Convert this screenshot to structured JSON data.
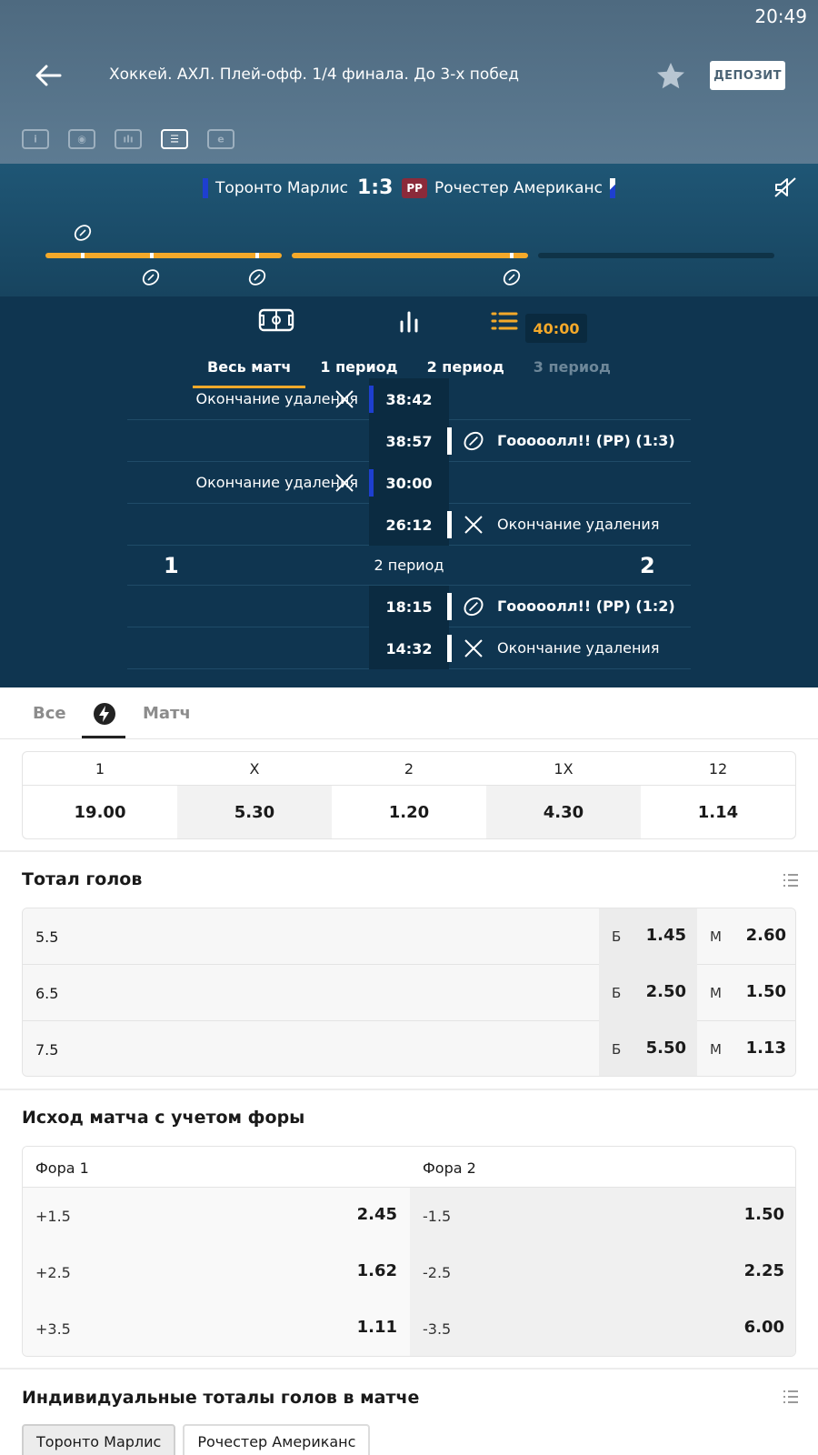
{
  "status": {
    "time": "20:49"
  },
  "header": {
    "title": "Хоккей. АХЛ. Плей-офф. 1/4 финала. До 3-х побед",
    "deposit_label": "ДЕПОЗИТ",
    "view_tabs": [
      "info",
      "field",
      "stats",
      "list",
      "e"
    ]
  },
  "scoreboard": {
    "home": "Торонто Марлис",
    "score": "1:3",
    "badge": "PP",
    "away": "Рочестер Американс"
  },
  "events_panel": {
    "timer": "40:00",
    "period_tabs": [
      "Весь матч",
      "1 период",
      "2 период",
      "3 период"
    ],
    "rows": [
      {
        "time": "38:42",
        "side": "left",
        "text": "Окончание удаления",
        "icon": "penalty-end-icon"
      },
      {
        "time": "38:57",
        "side": "right",
        "text": "Гооооолл!! (PP) (1:3)",
        "icon": "goal-puck-icon"
      },
      {
        "time": "30:00",
        "side": "left",
        "text": "Окончание удаления",
        "icon": "penalty-end-icon"
      },
      {
        "time": "26:12",
        "side": "right",
        "text": "Окончание удаления",
        "icon": "penalty-end-icon"
      },
      {
        "time": "18:15",
        "side": "right",
        "text": "Гооооолл!! (PP) (1:2)",
        "icon": "goal-puck-icon"
      },
      {
        "time": "14:32",
        "side": "right",
        "text": "Окончание удаления",
        "icon": "penalty-end-icon"
      }
    ],
    "separator": {
      "home": "1",
      "label": "2 период",
      "away": "2"
    }
  },
  "market_tabs": {
    "all": "Все",
    "match": "Матч"
  },
  "main_odds": {
    "headers": [
      "1",
      "X",
      "2",
      "1X",
      "12"
    ],
    "values": [
      "19.00",
      "5.30",
      "1.20",
      "4.30",
      "1.14"
    ]
  },
  "totals": {
    "title": "Тотал голов",
    "over_label": "Б",
    "under_label": "М",
    "rows": [
      {
        "line": "5.5",
        "over": "1.45",
        "under": "2.60"
      },
      {
        "line": "6.5",
        "over": "2.50",
        "under": "1.50"
      },
      {
        "line": "7.5",
        "over": "5.50",
        "under": "1.13"
      }
    ]
  },
  "handicap": {
    "title": "Исход матча с учетом форы",
    "head1": "Фора 1",
    "head2": "Фора 2",
    "rows": [
      {
        "h1": "+1.5",
        "o1": "2.45",
        "h2": "-1.5",
        "o2": "1.50"
      },
      {
        "h1": "+2.5",
        "o1": "1.62",
        "h2": "-2.5",
        "o2": "2.25"
      },
      {
        "h1": "+3.5",
        "o1": "1.11",
        "h2": "-3.5",
        "o2": "6.00"
      }
    ]
  },
  "individual": {
    "title": "Индивидуальные тоталы голов в матче",
    "teams": [
      "Торонто Марлис",
      "Рочестер Американс"
    ]
  },
  "colors": {
    "accent": "#f4a92a",
    "home_team": "#1e3fd0",
    "pp_badge": "#8b2a3a"
  }
}
